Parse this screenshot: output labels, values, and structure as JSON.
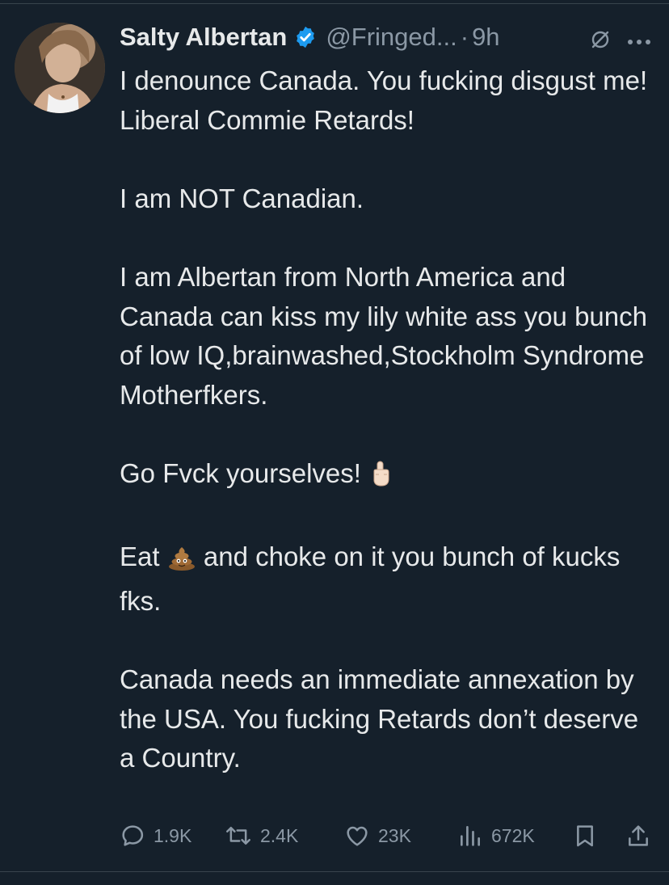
{
  "tweet": {
    "author_name": "Salty Albertan",
    "handle": "@Fringed...",
    "separator": "·",
    "time": "9h",
    "paragraphs": [
      {
        "parts": [
          {
            "type": "text",
            "value": "I denounce Canada. You fucking disgust me! Liberal Commie Retards!"
          }
        ]
      },
      {
        "parts": [
          {
            "type": "text",
            "value": "I am NOT Canadian."
          }
        ]
      },
      {
        "parts": [
          {
            "type": "text",
            "value": "I am Albertan from North America and Canada can kiss my lily white ass you bunch of low IQ,brainwashed,Stockholm Syndrome Motherfkers."
          }
        ]
      },
      {
        "parts": [
          {
            "type": "text",
            "value": "Go Fvck yourselves! "
          },
          {
            "type": "emoji",
            "icon": "middle-finger-emoji"
          }
        ]
      },
      {
        "parts": [
          {
            "type": "text",
            "value": "Eat "
          },
          {
            "type": "emoji",
            "icon": "pile-of-poo-emoji"
          },
          {
            "type": "text",
            "value": " and choke on it you bunch of kucks fks."
          }
        ]
      },
      {
        "parts": [
          {
            "type": "text",
            "value": "Canada needs an immediate annexation by the USA. You fucking Retards don’t deserve a Country."
          }
        ]
      }
    ]
  },
  "actions": {
    "reply_count": "1.9K",
    "retweet_count": "2.4K",
    "like_count": "23K",
    "view_count": "672K"
  },
  "icons": {
    "reply": "reply-icon",
    "retweet": "retweet-icon",
    "like": "heart-icon",
    "views": "views-icon",
    "bookmark": "bookmark-icon",
    "share": "share-icon",
    "verified": "verified-badge-icon",
    "grok": "grok-icon",
    "more": "more-icon"
  },
  "colors": {
    "background": "#15202b",
    "text": "#e7e9ea",
    "secondary": "#8b98a5",
    "verified": "#1d9bf0"
  }
}
